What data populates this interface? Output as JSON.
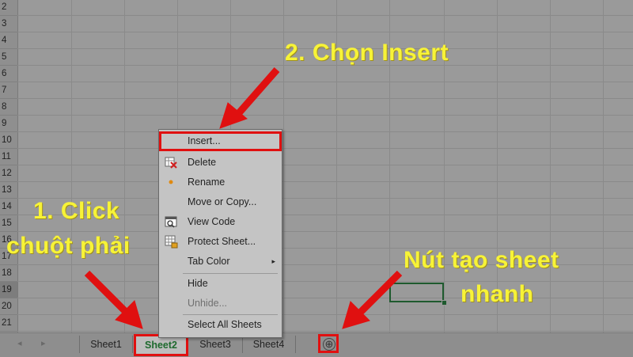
{
  "rows": [
    "2",
    "3",
    "4",
    "5",
    "6",
    "7",
    "8",
    "9",
    "10",
    "11",
    "12",
    "13",
    "14",
    "15",
    "16",
    "17",
    "18",
    "19",
    "20",
    "21"
  ],
  "selected_row": "19",
  "sheet_tabs": [
    "Sheet1",
    "Sheet2",
    "Sheet3",
    "Sheet4"
  ],
  "active_tab": "Sheet2",
  "add_sheet_symbol": "⊕",
  "context_menu": {
    "items": [
      {
        "label": "Insert...",
        "icon": "insert"
      },
      {
        "label": "Delete",
        "icon": "delete-sheet-icon"
      },
      {
        "label": "Rename",
        "icon": "rename-dot-icon"
      },
      {
        "label": "Move or Copy...",
        "icon": ""
      },
      {
        "label": "View Code",
        "icon": "view-code-icon"
      },
      {
        "label": "Protect Sheet...",
        "icon": "protect-sheet-icon"
      },
      {
        "label": "Tab Color",
        "icon": "",
        "submenu": "▸"
      },
      {
        "label": "Hide",
        "icon": ""
      },
      {
        "label": "Unhide...",
        "icon": "",
        "disabled": true
      },
      {
        "label": "Select All Sheets",
        "icon": ""
      }
    ]
  },
  "annotations": {
    "step1_line1": "1. Click",
    "step1_line2": "chuột phải",
    "step2": "2. Chọn Insert",
    "quick_line1": "Nút tạo sheet",
    "quick_line2": "nhanh"
  },
  "colors": {
    "annotation": "#f7f337",
    "highlight": "#e01010",
    "active_tab_text": "#1e6a2e"
  }
}
